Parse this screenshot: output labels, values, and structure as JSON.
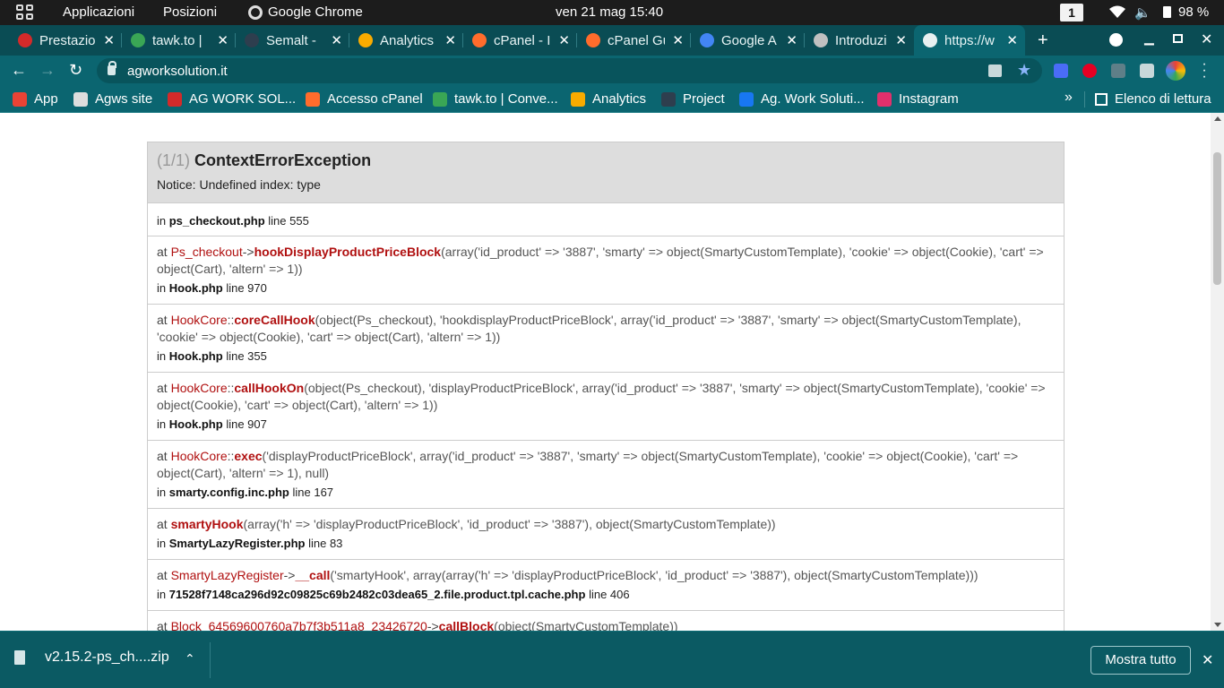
{
  "system": {
    "applications": "Applicazioni",
    "positions": "Posizioni",
    "app_name": "Google Chrome",
    "clock": "ven 21 mag  15:40",
    "workspace": "1",
    "battery": "98 %"
  },
  "tabs": [
    {
      "label": "Prestazio",
      "icon_color": "#d42a2a"
    },
    {
      "label": "tawk.to |",
      "icon_color": "#3aa655"
    },
    {
      "label": "Semalt -",
      "icon_color": "#2e3e4e"
    },
    {
      "label": "Analytics",
      "icon_color": "#f9ab00"
    },
    {
      "label": "cPanel - I",
      "icon_color": "#ff6c2c"
    },
    {
      "label": "cPanel Gu",
      "icon_color": "#ff6c2c"
    },
    {
      "label": "Google A",
      "icon_color": "#4285f4"
    },
    {
      "label": "Introduzi",
      "icon_color": "#c0c0c0"
    },
    {
      "label": "https://w",
      "icon_color": "#e8f0f1",
      "active": true
    }
  ],
  "tab_close": "✕",
  "new_tab": "+",
  "toolbar": {
    "url": "agworksolution.it"
  },
  "bookmarks": [
    {
      "label": "App",
      "icon_color": "#ea4335"
    },
    {
      "label": "Agws site",
      "icon_color": "#dddddd"
    },
    {
      "label": "AG WORK SOL...",
      "icon_color": "#d42a2a"
    },
    {
      "label": "Accesso cPanel",
      "icon_color": "#ff6c2c"
    },
    {
      "label": "tawk.to | Conve...",
      "icon_color": "#3aa655"
    },
    {
      "label": "Analytics",
      "icon_color": "#f9ab00"
    },
    {
      "label": "Project",
      "icon_color": "#2e3e4e"
    },
    {
      "label": "Ag. Work Soluti...",
      "icon_color": "#1877f2"
    },
    {
      "label": "Instagram",
      "icon_color": "#e1306c"
    }
  ],
  "reading_list": "Elenco di lettura",
  "exception": {
    "count": "(1/1)",
    "title": "ContextErrorException",
    "message": "Notice: Undefined index: type",
    "first_file": "ps_checkout.php",
    "first_line": "line 555"
  },
  "trace": [
    {
      "at": "at",
      "cls": "Ps_checkout",
      "sep": "->",
      "fn": "hookDisplayProductPriceBlock",
      "args": "(array('id_product' => '3887', 'smarty' => object(SmartyCustomTemplate), 'cookie' => object(Cookie), 'cart' => object(Cart), 'altern' => 1))",
      "in": "in",
      "file": "Hook.php",
      "line": "line 970"
    },
    {
      "at": "at",
      "cls": "HookCore",
      "sep": "::",
      "fn": "coreCallHook",
      "args": "(object(Ps_checkout), 'hookdisplayProductPriceBlock', array('id_product' => '3887', 'smarty' => object(SmartyCustomTemplate), 'cookie' => object(Cookie), 'cart' => object(Cart), 'altern' => 1))",
      "in": "in",
      "file": "Hook.php",
      "line": "line 355"
    },
    {
      "at": "at",
      "cls": "HookCore",
      "sep": "::",
      "fn": "callHookOn",
      "args": "(object(Ps_checkout), 'displayProductPriceBlock', array('id_product' => '3887', 'smarty' => object(SmartyCustomTemplate), 'cookie' => object(Cookie), 'cart' => object(Cart), 'altern' => 1))",
      "in": "in",
      "file": "Hook.php",
      "line": "line 907"
    },
    {
      "at": "at",
      "cls": "HookCore",
      "sep": "::",
      "fn": "exec",
      "args": "('displayProductPriceBlock', array('id_product' => '3887', 'smarty' => object(SmartyCustomTemplate), 'cookie' => object(Cookie), 'cart' => object(Cart), 'altern' => 1), null)",
      "in": "in",
      "file": "smarty.config.inc.php",
      "line": "line 167"
    },
    {
      "at": "at",
      "cls": "",
      "sep": "",
      "fn": "smartyHook",
      "args": "(array('h' => 'displayProductPriceBlock', 'id_product' => '3887'), object(SmartyCustomTemplate))",
      "in": "in",
      "file": "SmartyLazyRegister.php",
      "line": "line 83"
    },
    {
      "at": "at",
      "cls": "SmartyLazyRegister",
      "sep": "->",
      "fn": "__call",
      "args": "('smartyHook', array(array('h' => 'displayProductPriceBlock', 'id_product' => '3887'), object(SmartyCustomTemplate)))",
      "in": "in",
      "file": "71528f7148ca296d92c09825c69b2482c03dea65_2.file.product.tpl.cache.php",
      "line": "line 406"
    },
    {
      "at": "at",
      "cls": "Block_64569600760a7b7f3b511a8_23426720",
      "sep": "->",
      "fn": "callBlock",
      "args": "(object(SmartyCustomTemplate))",
      "in": "",
      "file": "",
      "line": ""
    }
  ],
  "downloads": {
    "file_name": "v2.15.2-ps_ch....zip",
    "show_all": "Mostra tutto"
  }
}
